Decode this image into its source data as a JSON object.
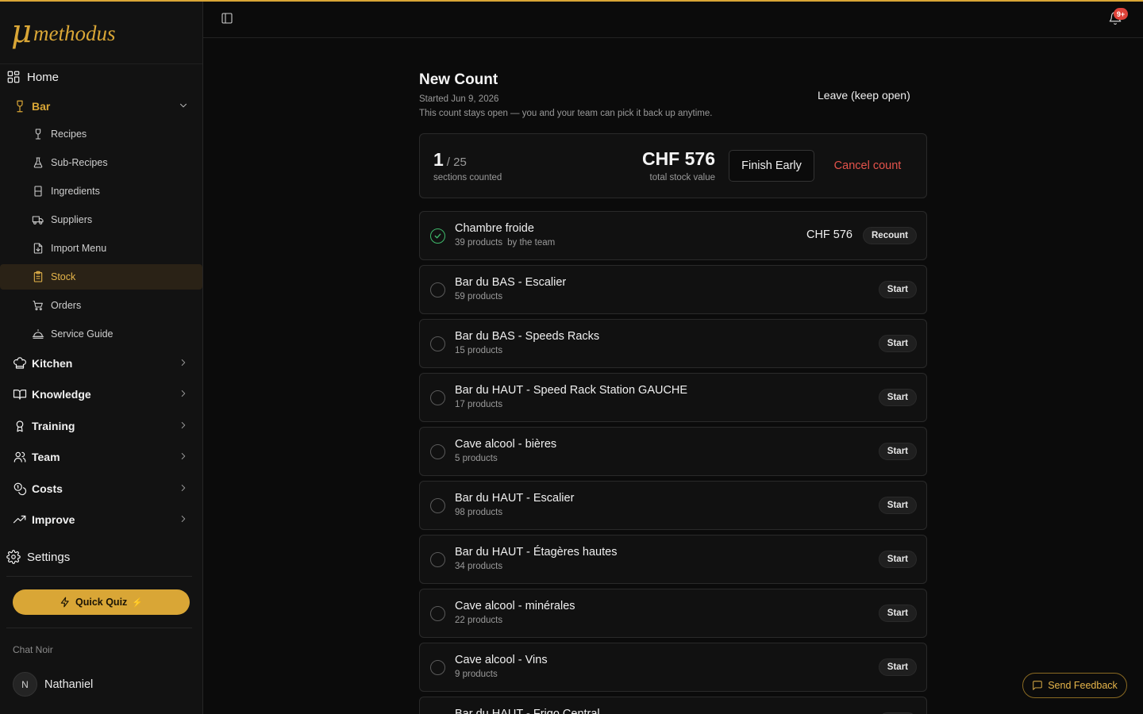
{
  "brand": {
    "mu": "μ",
    "word": "methodus",
    "accent": "#d9a636"
  },
  "sidebar": {
    "home": {
      "label": "Home",
      "icon": "dashboard-icon"
    },
    "bar": {
      "label": "Bar",
      "icon": "wine-glass-icon"
    },
    "bar_items": [
      {
        "label": "Recipes",
        "icon": "wine-glass-icon"
      },
      {
        "label": "Sub-Recipes",
        "icon": "flask-icon"
      },
      {
        "label": "Ingredients",
        "icon": "bottle-icon"
      },
      {
        "label": "Suppliers",
        "icon": "truck-icon"
      },
      {
        "label": "Import Menu",
        "icon": "file-import-icon"
      },
      {
        "label": "Stock",
        "icon": "clipboard-icon"
      },
      {
        "label": "Orders",
        "icon": "cart-icon"
      },
      {
        "label": "Service Guide",
        "icon": "cloche-icon"
      }
    ],
    "groups": [
      {
        "label": "Kitchen",
        "icon": "chef-hat-icon"
      },
      {
        "label": "Knowledge",
        "icon": "book-icon"
      },
      {
        "label": "Training",
        "icon": "award-icon"
      },
      {
        "label": "Team",
        "icon": "users-icon"
      },
      {
        "label": "Costs",
        "icon": "coins-icon"
      },
      {
        "label": "Improve",
        "icon": "trend-up-icon"
      }
    ],
    "settings": {
      "label": "Settings",
      "icon": "gear-icon"
    },
    "quiz_label": "Quick Quiz",
    "quiz_spark": "⚡",
    "org_name": "Chat Noir",
    "user": {
      "initial": "N",
      "name": "Nathaniel"
    }
  },
  "header": {
    "notifications_badge": "9+"
  },
  "count": {
    "title": "New Count",
    "started": "Started Jun 9, 2026",
    "description": "This count stays open — you and your team can pick it back up anytime.",
    "leave_label": "Leave (keep open)",
    "counted": "1",
    "total": "/ 25",
    "counted_label": "sections counted",
    "stock_value": "CHF 576",
    "stock_value_label": "total stock value",
    "finish_label": "Finish Early",
    "cancel_label": "Cancel count"
  },
  "sections": [
    {
      "name": "Chambre froide",
      "products": "39 products",
      "by": "by the team",
      "value": "CHF 576",
      "action": "Recount",
      "done": true
    },
    {
      "name": "Bar du BAS - Escalier",
      "products": "59 products",
      "by": "",
      "value": "",
      "action": "Start",
      "done": false
    },
    {
      "name": "Bar du BAS - Speeds Racks",
      "products": "15 products",
      "by": "",
      "value": "",
      "action": "Start",
      "done": false
    },
    {
      "name": "Bar du HAUT - Speed Rack Station GAUCHE",
      "products": "17 products",
      "by": "",
      "value": "",
      "action": "Start",
      "done": false
    },
    {
      "name": "Cave alcool - bières",
      "products": "5 products",
      "by": "",
      "value": "",
      "action": "Start",
      "done": false
    },
    {
      "name": "Bar du HAUT - Escalier",
      "products": "98 products",
      "by": "",
      "value": "",
      "action": "Start",
      "done": false
    },
    {
      "name": "Bar du HAUT - Étagères hautes",
      "products": "34 products",
      "by": "",
      "value": "",
      "action": "Start",
      "done": false
    },
    {
      "name": "Cave alcool - minérales",
      "products": "22 products",
      "by": "",
      "value": "",
      "action": "Start",
      "done": false
    },
    {
      "name": "Cave alcool - Vins",
      "products": "9 products",
      "by": "",
      "value": "",
      "action": "Start",
      "done": false
    },
    {
      "name": "Bar du HAUT - Frigo Central",
      "products": "",
      "by": "",
      "value": "",
      "action": "Start",
      "done": false
    }
  ],
  "feedback_label": "Send Feedback"
}
